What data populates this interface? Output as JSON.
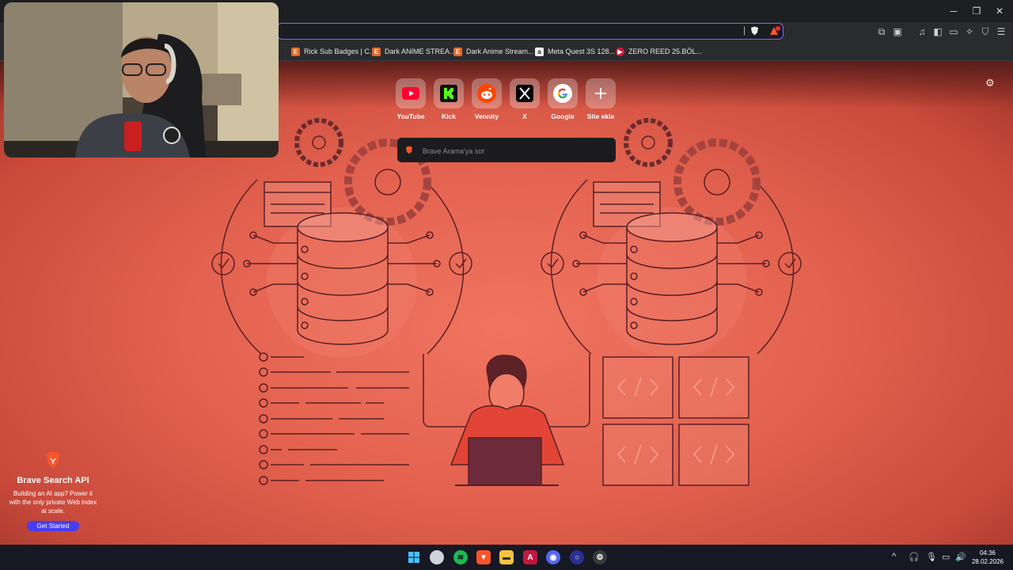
{
  "window_controls": {
    "minimize": "─",
    "restore": "❐",
    "close": "✕"
  },
  "bookmarks": [
    {
      "label": "Rick Sub Badges | C...",
      "favicon": "E",
      "color": "#e0682b"
    },
    {
      "label": "Dark ANIME STREA...",
      "favicon": "E",
      "color": "#e0682b"
    },
    {
      "label": "Dark Anime Stream...",
      "favicon": "E",
      "color": "#e0682b"
    },
    {
      "label": "Meta Quest 3S 128...",
      "favicon": "a",
      "color": "#f2f2f2"
    },
    {
      "label": "ZERO REED 25.BÖL...",
      "favicon": "▶",
      "color": "#cc1a3a"
    }
  ],
  "shortcuts": [
    {
      "label": "YouTube",
      "icon": "youtube-icon"
    },
    {
      "label": "Kick",
      "icon": "kick-icon"
    },
    {
      "label": "Vennity",
      "icon": "reddit-icon"
    },
    {
      "label": "X",
      "icon": "x-icon"
    },
    {
      "label": "Google",
      "icon": "google-icon"
    },
    {
      "label": "Site ekle",
      "icon": "plus-icon"
    }
  ],
  "search": {
    "placeholder": "Brave Arama'ya sor"
  },
  "promo": {
    "title": "Brave Search API",
    "text": "Building an AI app? Power it with the only private Web index at scale.",
    "button": "Get Started"
  },
  "taskbar": {
    "time": "04:36",
    "date": "28.02.2026"
  },
  "colors": {
    "accent": "#7b61ff",
    "promo_button": "#4a3cf0",
    "brave": "#fb542b"
  }
}
